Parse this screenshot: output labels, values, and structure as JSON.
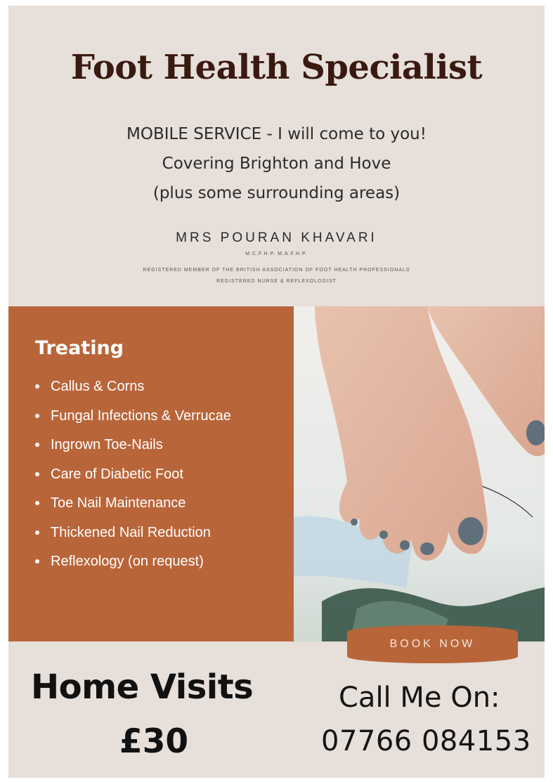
{
  "header": {
    "title": "Foot Health Specialist",
    "line1": "MOBILE SERVICE - I will come to you!",
    "line2": "Covering Brighton and Hove",
    "line3": "(plus some surrounding areas)"
  },
  "practitioner": {
    "name": "MRS POURAN KHAVARI",
    "credentials": "M.C.F.H.P. M.A.F.H.P.",
    "membership": "REGISTERED MEMBER OF THE BRITISH ASSOCIATION OF FOOT HEALTH PROFESSIONALS",
    "roles": "REGISTERED NURSE & REFLEXOLOGIST"
  },
  "treating": {
    "heading": "Treating",
    "items": [
      "Callus & Corns",
      "Fungal Infections & Verrucae",
      "Ingrown Toe-Nails",
      "Care of Diabetic Foot",
      "Toe Nail Maintenance",
      "Thickened Nail Reduction",
      "Reflexology (on request)"
    ]
  },
  "cta": {
    "book_label": "BOOK NOW"
  },
  "footer": {
    "home_visits": "Home Visits",
    "price": "£30",
    "call_label": "Call Me On:",
    "phone": "07766 084153"
  },
  "colors": {
    "background": "#e6dfda",
    "accent": "#b9653a",
    "title": "#3a1a10",
    "nail_polish": "#5f707b"
  },
  "image": {
    "subject": "bare-feet-with-grey-painted-toenails"
  }
}
